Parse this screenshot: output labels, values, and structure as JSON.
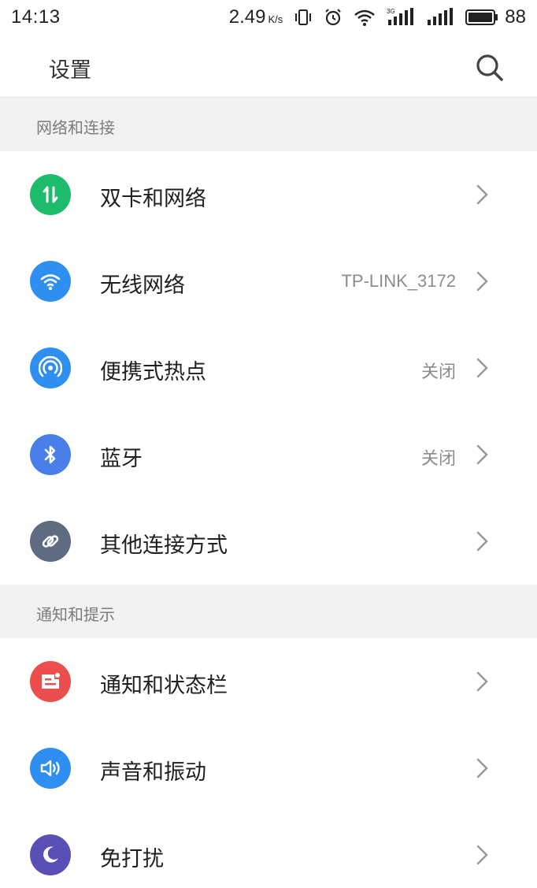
{
  "status_bar": {
    "time": "14:13",
    "net_speed": "2.49",
    "net_speed_unit": "K/s",
    "signal_label": "3G",
    "battery": "88"
  },
  "header": {
    "title": "设置",
    "search_icon": "search-icon"
  },
  "sections": [
    {
      "title": "网络和连接",
      "items": [
        {
          "label": "双卡和网络",
          "value": "",
          "icon": "dual-sim-icon",
          "color": "#1dbb6c"
        },
        {
          "label": "无线网络",
          "value": "TP-LINK_3172",
          "icon": "wifi-icon",
          "color": "#2f8ff0"
        },
        {
          "label": "便携式热点",
          "value": "关闭",
          "icon": "hotspot-icon",
          "color": "#2f8ff0"
        },
        {
          "label": "蓝牙",
          "value": "关闭",
          "icon": "bluetooth-icon",
          "color": "#4a7fea"
        },
        {
          "label": "其他连接方式",
          "value": "",
          "icon": "link-icon",
          "color": "#5e6b80"
        }
      ]
    },
    {
      "title": "通知和提示",
      "items": [
        {
          "label": "通知和状态栏",
          "value": "",
          "icon": "notification-icon",
          "color": "#ec4d4d"
        },
        {
          "label": "声音和振动",
          "value": "",
          "icon": "sound-icon",
          "color": "#2f8ff0"
        },
        {
          "label": "免打扰",
          "value": "",
          "icon": "moon-icon",
          "color": "#5a4fb5"
        }
      ]
    }
  ]
}
